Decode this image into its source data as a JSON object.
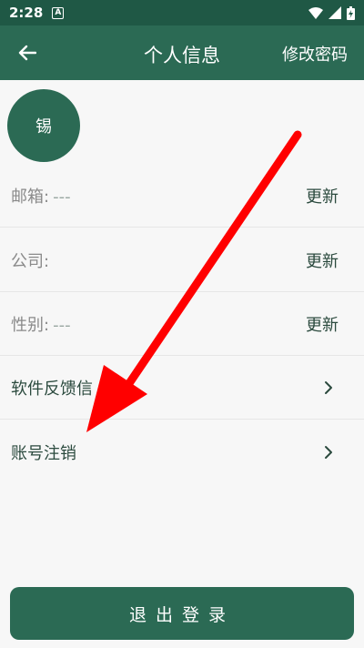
{
  "status_bar": {
    "time": "2:28",
    "notification_icon": "A"
  },
  "app_bar": {
    "title": "个人信息",
    "action": "修改密码"
  },
  "avatar": {
    "text": "锡"
  },
  "rows": [
    {
      "label": "邮箱:",
      "value": "---",
      "action": "更新"
    },
    {
      "label": "公司:",
      "value": "",
      "action": "更新"
    },
    {
      "label": "性别:",
      "value": "---",
      "action": "更新"
    },
    {
      "label": "软件反馈信"
    },
    {
      "label": "账号注销"
    }
  ],
  "logout": {
    "label": "退出登录"
  },
  "colors": {
    "primary": "#2b6a54",
    "status": "#1f5845",
    "arrow": "#ff0000"
  }
}
